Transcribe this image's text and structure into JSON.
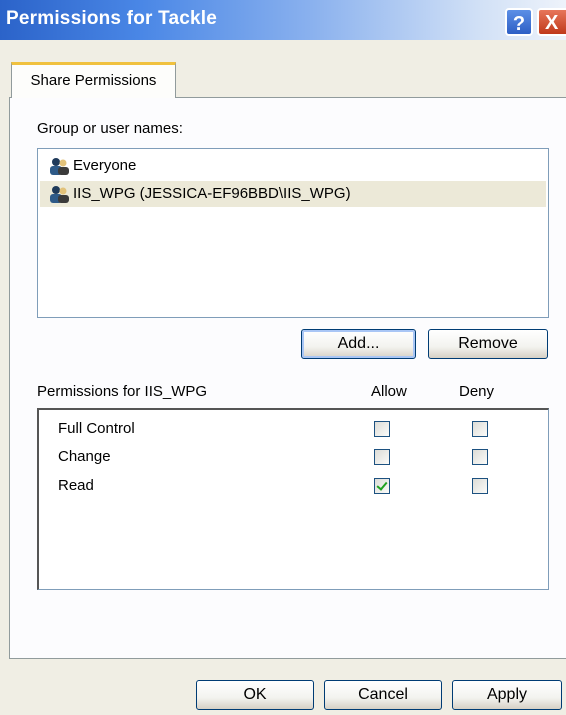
{
  "window": {
    "title": "Permissions for Tackle",
    "help_glyph": "?",
    "close_glyph": "X"
  },
  "tabs": [
    {
      "label": "Share Permissions",
      "active": true
    }
  ],
  "group_label": "Group or user names:",
  "users": [
    {
      "name": "Everyone",
      "selected": false,
      "icon": "user-group-icon"
    },
    {
      "name": "IIS_WPG (JESSICA-EF96BBD\\IIS_WPG)",
      "selected": true,
      "icon": "user-group-icon"
    }
  ],
  "buttons": {
    "add": "Add...",
    "remove": "Remove",
    "ok": "OK",
    "cancel": "Cancel",
    "apply": "Apply"
  },
  "permissions": {
    "header": "Permissions for IIS_WPG",
    "allow_label": "Allow",
    "deny_label": "Deny",
    "rows": [
      {
        "name": "Full Control",
        "allow": false,
        "deny": false
      },
      {
        "name": "Change",
        "allow": false,
        "deny": false
      },
      {
        "name": "Read",
        "allow": true,
        "deny": false
      }
    ]
  },
  "colors": {
    "title_gradient_start": "#2b63c9",
    "dialog_bg": "#f0eee4",
    "tab_highlight": "#f0c13e",
    "check_green": "#21a121"
  }
}
